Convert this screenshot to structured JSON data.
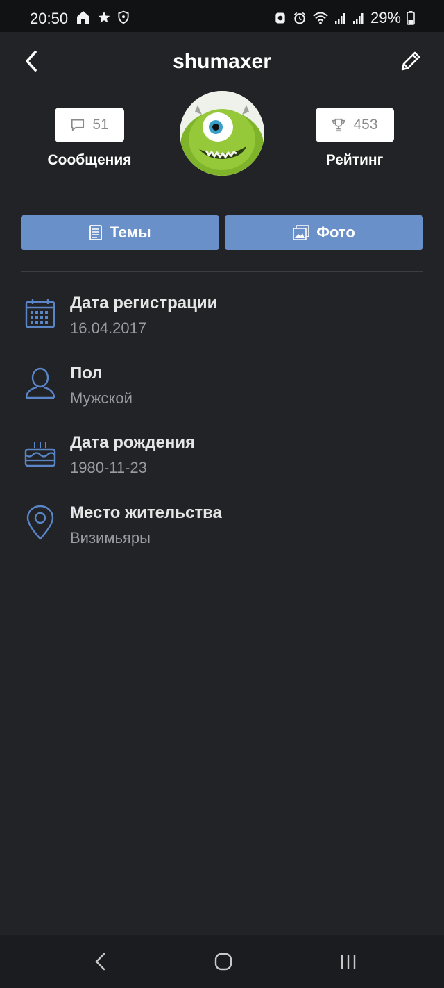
{
  "status_bar": {
    "time": "20:50",
    "left_icons": [
      "home-icon",
      "star-icon",
      "shield-icon"
    ],
    "right_icons": [
      "alarm-icon",
      "clock-icon",
      "wifi-icon",
      "signal-icon",
      "signal-icon"
    ],
    "battery": "29%"
  },
  "header": {
    "title": "shumaxer",
    "back_icon": "chevron-left-icon",
    "edit_icon": "pencil-icon"
  },
  "stats": {
    "messages": {
      "count": "51",
      "label": "Сообщения",
      "icon": "chat-bubble-icon"
    },
    "rating": {
      "count": "453",
      "label": "Рейтинг",
      "icon": "trophy-icon"
    }
  },
  "buttons": {
    "topics": "Темы",
    "photo": "Фото"
  },
  "info": [
    {
      "title": "Дата регистрации",
      "value": "16.04.2017",
      "icon": "calendar-icon"
    },
    {
      "title": "Пол",
      "value": "Мужской",
      "icon": "user-icon"
    },
    {
      "title": "Дата рождения",
      "value": "1980-11-23",
      "icon": "cake-icon"
    },
    {
      "title": "Место жительства",
      "value": "Визимьяры",
      "icon": "location-pin-icon"
    }
  ],
  "colors": {
    "background": "#222326",
    "accent": "#6a90c9",
    "icon_blue": "#5a86c8"
  }
}
